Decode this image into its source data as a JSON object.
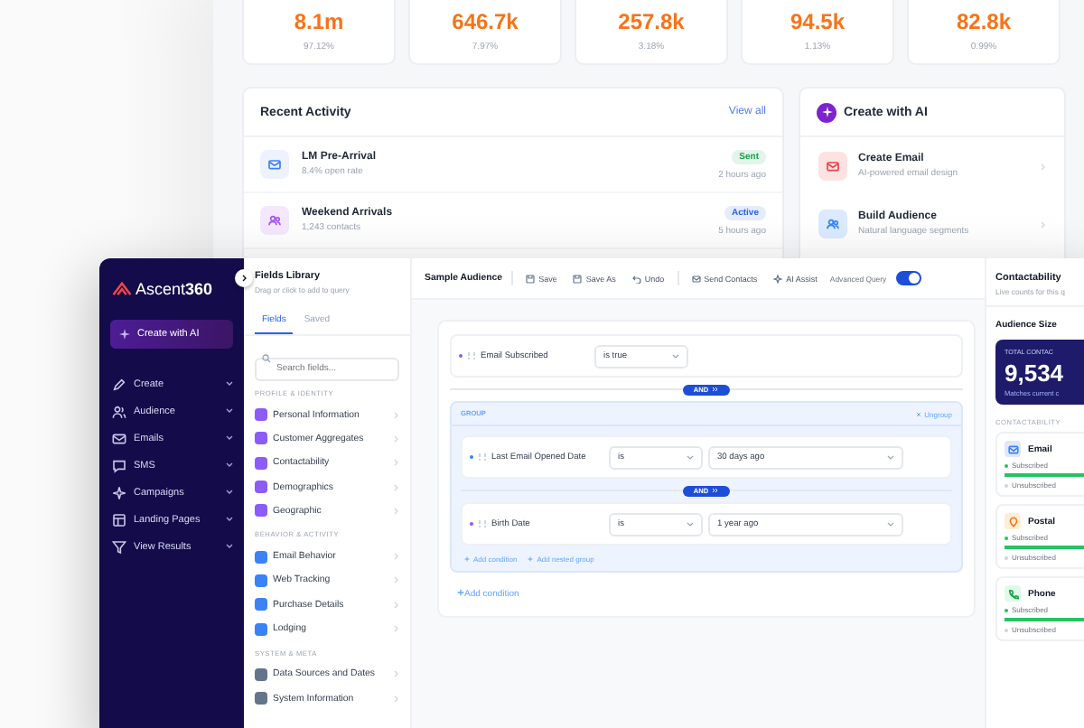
{
  "dashboard": {
    "stats": [
      {
        "value": "8.1m",
        "percent": "97.12%"
      },
      {
        "value": "646.7k",
        "percent": "7.97%"
      },
      {
        "value": "257.8k",
        "percent": "3.18%"
      },
      {
        "value": "94.5k",
        "percent": "1.13%"
      },
      {
        "value": "82.8k",
        "percent": "0.99%"
      }
    ],
    "recent_activity": {
      "title": "Recent Activity",
      "link": "View all",
      "items": [
        {
          "kind": "email",
          "name": "LM Pre-Arrival",
          "detail": "8.4% open rate",
          "status": "Sent",
          "color": "#16a34a",
          "time": "2 hours ago"
        },
        {
          "kind": "audience",
          "name": "Weekend Arrivals",
          "detail": "1,243 contacts",
          "status": "Active",
          "color": "#2563eb",
          "time": "5 hours ago"
        }
      ]
    },
    "create_with_ai": {
      "title": "Create with AI",
      "items": [
        {
          "kind": "email",
          "title": "Create Email",
          "subtitle": "AI-powered email design"
        },
        {
          "kind": "audience",
          "title": "Build Audience",
          "subtitle": "Natural language segments"
        }
      ]
    }
  },
  "app": {
    "sidebar": {
      "logo": {
        "text": "Ascent",
        "accent": "360"
      },
      "ai_button": "Create with AI",
      "items": [
        {
          "kind": "pencil",
          "label": "Create"
        },
        {
          "kind": "people",
          "label": "Audience"
        },
        {
          "kind": "mail",
          "label": "Emails"
        },
        {
          "kind": "chat",
          "label": "SMS"
        },
        {
          "kind": "spark",
          "label": "Campaigns"
        },
        {
          "kind": "layout",
          "label": "Landing Pages"
        },
        {
          "kind": "funnel",
          "label": "View Results"
        }
      ]
    },
    "fields_library": {
      "title": "Fields Library",
      "subtitle": "Drag or click to add to query",
      "tabs": [
        {
          "label": "Fields",
          "selected": true
        },
        {
          "label": "Saved",
          "selected": false
        }
      ],
      "search": {
        "placeholder": "Search fields..."
      },
      "sections": [
        {
          "title": "PROFILE & IDENTITY",
          "color": "#8b5cf6",
          "items": [
            "Personal Information",
            "Customer Aggregates",
            "Contactability",
            "Demographics",
            "Geographic"
          ]
        },
        {
          "title": "BEHAVIOR & ACTIVITY",
          "color": "#3b82f6",
          "items": [
            "Email Behavior",
            "Web Tracking",
            "Purchase Details",
            "Lodging"
          ]
        },
        {
          "title": "SYSTEM & META",
          "color": "#64748b",
          "items": [
            "Data Sources and Dates",
            "System Information"
          ]
        }
      ]
    },
    "toolbar": {
      "title": "Sample Audience",
      "actions": [
        {
          "kind": "save",
          "label": "Save"
        },
        {
          "kind": "save",
          "label": "Save As"
        },
        {
          "kind": "undo",
          "label": "Undo"
        },
        {
          "kind": "send",
          "label": "Send Contacts"
        },
        {
          "kind": "ai",
          "label": "AI Assist"
        }
      ],
      "advanced_query": {
        "label": "Advanced Query",
        "on": true
      }
    },
    "query": {
      "connector": "AND",
      "items": [
        {
          "kind": "condition",
          "color": "#8b5cf6",
          "field": "Email Subscribed",
          "operator": "is true"
        },
        {
          "kind": "group",
          "label": "GROUP",
          "ungroup": "Ungroup",
          "connector": "AND",
          "conditions": [
            {
              "color": "#3b82f6",
              "field": "Last Email Opened Date",
              "operator": "is",
              "value": "30 days ago"
            },
            {
              "color": "#8b5cf6",
              "field": "Birth Date",
              "operator": "is",
              "value": "1 year ago"
            }
          ],
          "add_condition": "Add condition",
          "add_group": "Add nested group"
        }
      ],
      "add_condition": "Add condition"
    },
    "contact_panel": {
      "title": "Contactability",
      "subtitle": "Live counts for this q",
      "audience_title": "Audience Size",
      "total": {
        "label": "TOTAL CONTAC",
        "value": "9,534",
        "note": "Matches current c"
      },
      "section": "CONTACTABILITY",
      "channels": [
        {
          "kind": "email",
          "name": "Email",
          "subscribed": "Subscribed",
          "unsubscribed": "Unsubscribed",
          "level": 1
        },
        {
          "kind": "postal",
          "name": "Postal",
          "subscribed": "Subscribed",
          "unsubscribed": "Unsubscribed",
          "level": 1
        },
        {
          "kind": "phone",
          "name": "Phone",
          "subscribed": "Subscribed",
          "unsubscribed": "Unsubscribed",
          "level": 1
        }
      ]
    }
  }
}
